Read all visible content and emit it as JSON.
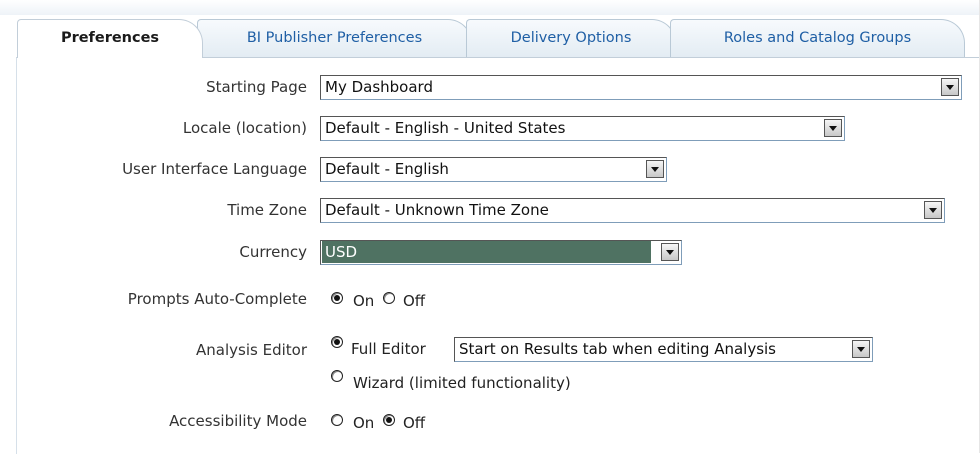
{
  "tabs": [
    {
      "label": "Preferences",
      "active": true
    },
    {
      "label": "BI Publisher Preferences",
      "active": false
    },
    {
      "label": "Delivery Options",
      "active": false
    },
    {
      "label": "Roles and Catalog Groups",
      "active": false
    }
  ],
  "form": {
    "starting_page": {
      "label": "Starting Page",
      "value": "My Dashboard"
    },
    "locale": {
      "label": "Locale (location)",
      "value": "Default - English - United States"
    },
    "ui_language": {
      "label": "User Interface Language",
      "value": "Default - English"
    },
    "time_zone": {
      "label": "Time Zone",
      "value": "Default - Unknown Time Zone"
    },
    "currency": {
      "label": "Currency",
      "value": "USD"
    },
    "prompts_auto_complete": {
      "label": "Prompts Auto-Complete",
      "options": [
        "On",
        "Off"
      ],
      "selected": "On"
    },
    "analysis_editor": {
      "label": "Analysis Editor",
      "full_editor_label": "Full Editor",
      "full_editor_mode": "Start on Results tab when editing Analysis",
      "wizard_label": "Wizard (limited functionality)",
      "selected": "Full Editor"
    },
    "accessibility_mode": {
      "label": "Accessibility Mode",
      "options": [
        "On",
        "Off"
      ],
      "selected": "Off"
    }
  },
  "colors": {
    "tab_text": "#1f5fa5",
    "focus_highlight": "#4f7262",
    "tab_border": "#b9c9d6"
  }
}
